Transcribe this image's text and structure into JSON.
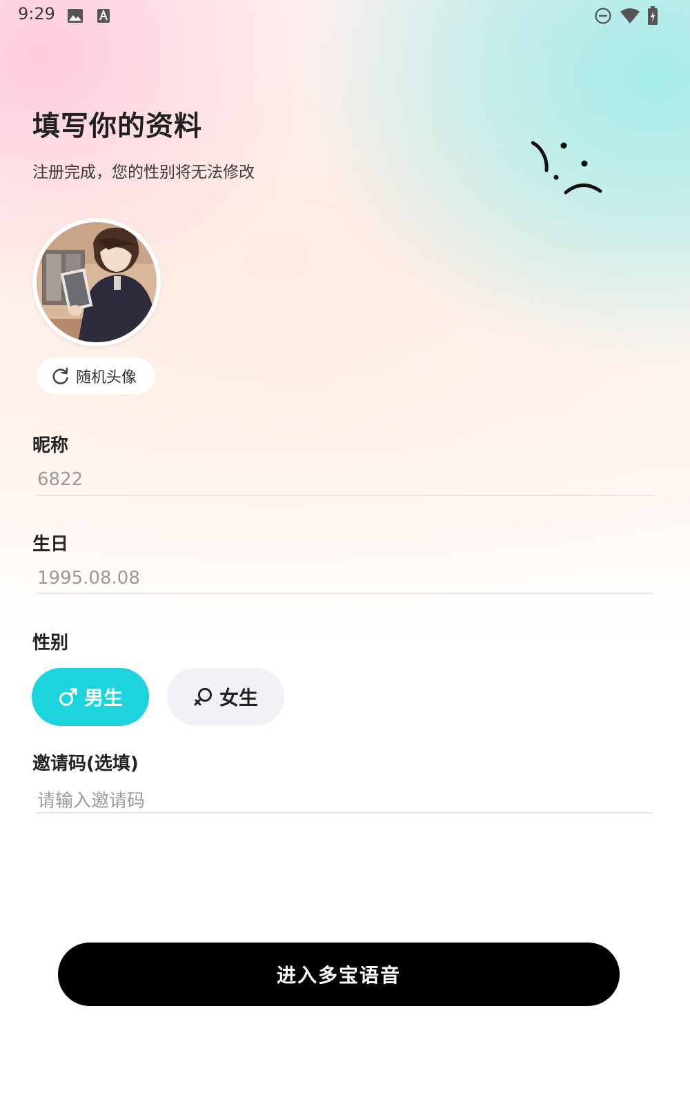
{
  "status_bar": {
    "time": "9:29",
    "icons": [
      "image-icon",
      "text-a-icon",
      "do-not-disturb-icon",
      "wifi-icon",
      "battery-charging-icon"
    ]
  },
  "header": {
    "title": "填写你的资料",
    "subtitle": "注册完成，您的性别将无法修改"
  },
  "avatar": {
    "random_label": "随机头像"
  },
  "form": {
    "nickname": {
      "label": "昵称",
      "value": "6822"
    },
    "birthday": {
      "label": "生日",
      "value": "1995.08.08"
    },
    "gender": {
      "label": "性别",
      "male_label": "男生",
      "female_label": "女生",
      "selected": "男生"
    },
    "invite": {
      "label": "邀请码(选填)",
      "placeholder": "请输入邀请码"
    }
  },
  "submit": {
    "label": "进入多宝语音"
  },
  "colors": {
    "accent": "#1dd4de",
    "submit_bg": "#000000",
    "unselected_bg": "#f1f2f5"
  }
}
